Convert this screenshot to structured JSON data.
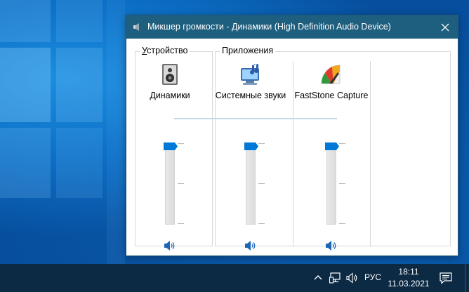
{
  "window": {
    "title": "Микшер громкости - Динамики (High Definition Audio Device)",
    "close_glyph": "✕"
  },
  "groups": {
    "device": {
      "label_prefix": "",
      "label_underlined": "У",
      "label_rest": "стройство"
    },
    "apps": {
      "label": "Приложения"
    }
  },
  "channels": [
    {
      "name": "Динамики",
      "icon": "speaker-device-icon",
      "volume_percent": 100,
      "muted": false
    },
    {
      "name": "Системные звуки",
      "icon": "system-sounds-icon",
      "volume_percent": 100,
      "muted": false
    },
    {
      "name": "FastStone Capture",
      "icon": "faststone-capture-icon",
      "volume_percent": 100,
      "muted": false
    }
  ],
  "taskbar": {
    "language": "РУС",
    "time": "18:11",
    "date": "11.03.2021"
  },
  "colors": {
    "titlebar": "#1e5e7e",
    "accent": "#0078d7",
    "taskbar": "#0c2a44"
  }
}
